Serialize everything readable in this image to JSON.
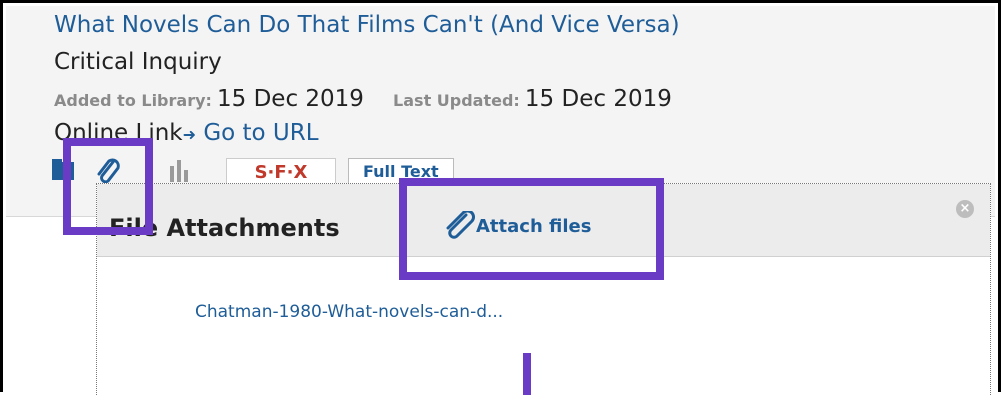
{
  "record": {
    "title": "What Novels Can Do That Films Can't (And Vice Versa)",
    "journal": "Critical Inquiry",
    "added_label": "Added to Library:",
    "added_value": "15 Dec 2019",
    "updated_label": "Last Updated:",
    "updated_value": "15 Dec 2019",
    "online_label": "Online Link",
    "online_arrow": "➜",
    "online_link": "Go to URL"
  },
  "toolbar": {
    "icons": [
      "folder-icon",
      "paperclip-icon",
      "bar-chart-icon"
    ],
    "sfx_label": "S·F·X",
    "full_text_label": "Full Text"
  },
  "attachments_popup": {
    "title": "File Attachments",
    "attach_label": "Attach files",
    "close_glyph": "×",
    "files": [
      "Chatman-1980-What-novels-can-d..."
    ]
  },
  "annotation_color": "#6a3bc4"
}
